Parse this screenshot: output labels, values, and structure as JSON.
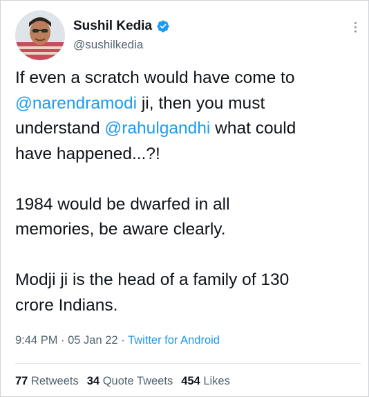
{
  "author": {
    "display_name": "Sushil Kedia",
    "handle": "@sushilkedia"
  },
  "tweet": {
    "line1_pre": "If even a scratch would have come to",
    "mention1": "@narendramodi",
    "line2_post": " ji, then you must",
    "line3_pre": "understand ",
    "mention2": "@rahulgandhi",
    "line3_post": " what could",
    "line4": "have happened...?!",
    "para2_line1": "1984 would be dwarfed in all",
    "para2_line2": "memories, be aware clearly.",
    "para3_line1": "Modji ji is the head of a family of 130",
    "para3_line2": "crore Indians."
  },
  "meta": {
    "time": "9:44 PM",
    "sep1": " · ",
    "date": "05 Jan 22",
    "sep2": " · ",
    "source": "Twitter for Android"
  },
  "stats": {
    "retweets_count": "77",
    "retweets_label": "Retweets",
    "quotes_count": "34",
    "quotes_label": "Quote Tweets",
    "likes_count": "454",
    "likes_label": "Likes"
  },
  "colors": {
    "link": "#1d9bf0",
    "text": "#0f1419",
    "muted": "#536471"
  }
}
